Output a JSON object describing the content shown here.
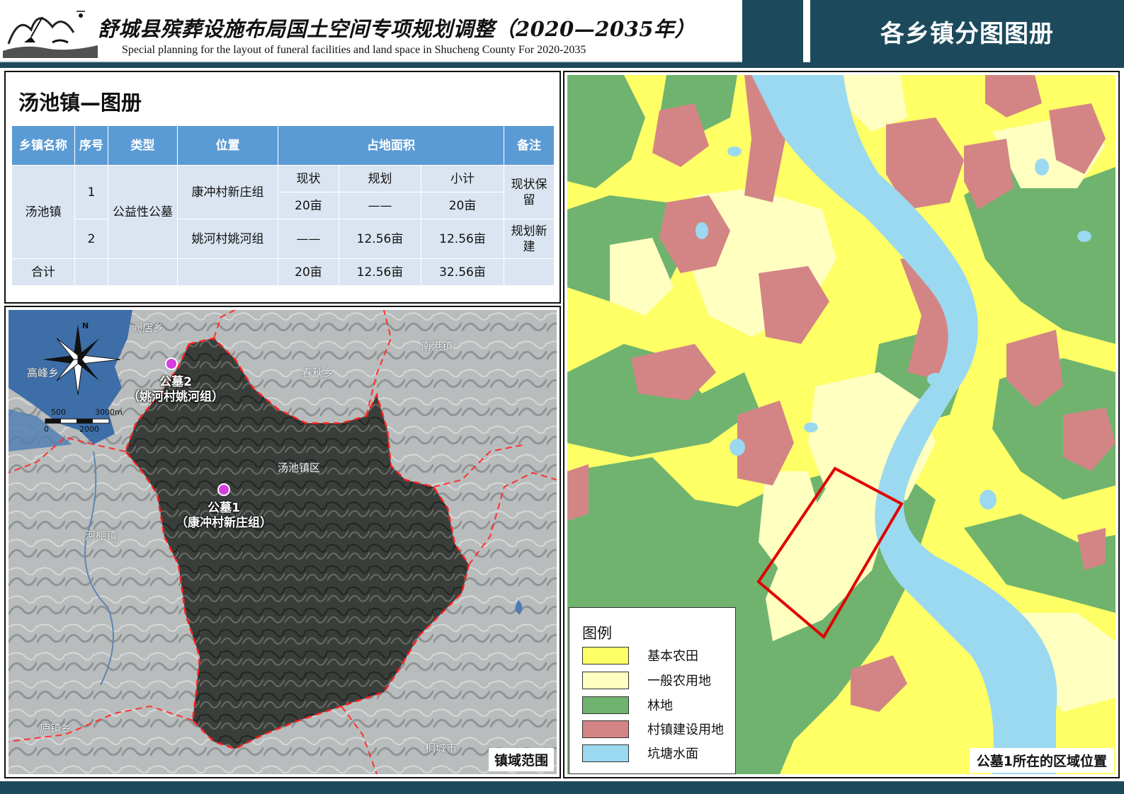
{
  "header": {
    "title_cn": "舒城县殡葬设施布局国土空间专项规划调整（2020—2035年）",
    "title_en": "Special planning for the layout of funeral facilities and land space in Shucheng County For 2020-2035",
    "section_title": "各乡镇分图图册"
  },
  "table_panel": {
    "title": "汤池镇—图册",
    "head": {
      "town": "乡镇名称",
      "seq": "序号",
      "type": "类型",
      "location": "位置",
      "area": "占地面积",
      "note": "备注"
    },
    "sub_head": {
      "current": "现状",
      "planned": "规划",
      "subtotal": "小计"
    },
    "town_name": "汤池镇",
    "type_value": "公益性公墓",
    "rows": [
      {
        "seq": "1",
        "location": "康冲村新庄组",
        "current": "20亩",
        "planned": "——",
        "subtotal": "20亩",
        "note": "现状保留"
      },
      {
        "seq": "2",
        "location": "姚河村姚河组",
        "current": "——",
        "planned": "12.56亩",
        "subtotal": "12.56亩",
        "note": "规划新建"
      }
    ],
    "total": {
      "label": "合计",
      "current": "20亩",
      "planned": "12.56亩",
      "subtotal": "32.56亩"
    }
  },
  "satellite_map": {
    "places": {
      "yuedian": "阙店乡",
      "gaofeng": "高峰乡",
      "nangang": "南港镇",
      "chunqiu": "春秋乡",
      "tangchi_district": "汤池镇区",
      "hepeng": "河棚镇",
      "miaochong": "庐镇乡",
      "tongcheng": "桐城市"
    },
    "compass_letter": "N",
    "scale": {
      "t0": "0",
      "t500": "500",
      "t2000": "2000",
      "t3000": "3000m"
    },
    "cemetery_1": {
      "name": "公墓1",
      "location": "（康冲村新庄组）"
    },
    "cemetery_2": {
      "name": "公墓2",
      "location": "（姚河村姚河组）"
    },
    "marker_color": "#d63ee0",
    "corner_label": "镇域范围"
  },
  "landuse_map": {
    "legend_title": "图例",
    "legend": [
      {
        "label": "基本农田",
        "color": "#ffff66"
      },
      {
        "label": "一般农用地",
        "color": "#ffffc0"
      },
      {
        "label": "林地",
        "color": "#6fb36f"
      },
      {
        "label": "村镇建设用地",
        "color": "#d38585"
      },
      {
        "label": "坑塘水面",
        "color": "#9ad9f0"
      }
    ],
    "highlight_color": "#e00000",
    "corner_label": "公墓1所在的区域位置"
  }
}
